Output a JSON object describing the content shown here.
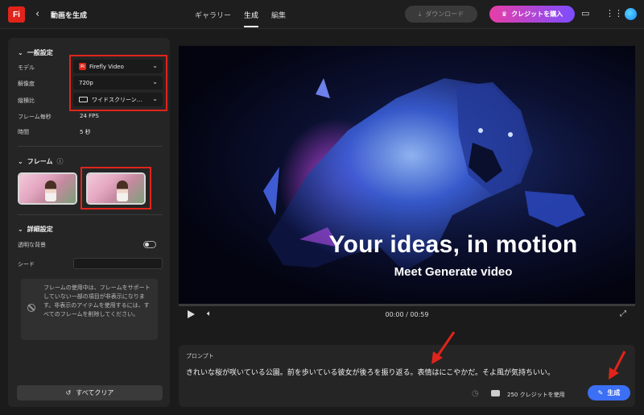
{
  "app": {
    "logo": "Fi",
    "page_title": "動画を生成"
  },
  "nav": {
    "tabs": [
      "ギャラリー",
      "生成",
      "編集"
    ],
    "active": "生成"
  },
  "header": {
    "download_label": "ダウンロード",
    "buy_credits_label": "クレジットを購入"
  },
  "general": {
    "heading": "一般設定",
    "model_label": "モデル",
    "model_value": "Firefly Video",
    "resolution_label": "解像度",
    "resolution_value": "720p",
    "aspect_label": "縦横比",
    "aspect_value": "ワイドスクリーン…",
    "fps_label": "フレーム毎秒",
    "fps_value": "24 FPS",
    "duration_label": "時間",
    "duration_value": "5 秒"
  },
  "frames": {
    "heading": "フレーム"
  },
  "advanced": {
    "heading": "詳細設定",
    "transparent_label": "透明な背景",
    "seed_label": "シード",
    "notice": "フレームの使用中は、フレームをサポートしていない一部の項目が非表示になります。非表示のアイテムを使用するには、すべてのフレームを削除してください。"
  },
  "clear_all_label": "すべてクリア",
  "video": {
    "headline": "Your ideas, in motion",
    "subheadline": "Meet Generate video",
    "time": "00:00 / 00:59"
  },
  "prompt": {
    "label": "プロンプト",
    "text": "きれいな桜が咲いている公園。前を歩いている彼女が後ろを振り返る。表情はにこやかだ。そよ風が気持ちいい。",
    "credits": "250 クレジットを使用",
    "generate_label": "生成"
  },
  "colors": {
    "accent": "#3b6ff5",
    "brand": "#e0241b",
    "highlight": "#e0241b"
  }
}
